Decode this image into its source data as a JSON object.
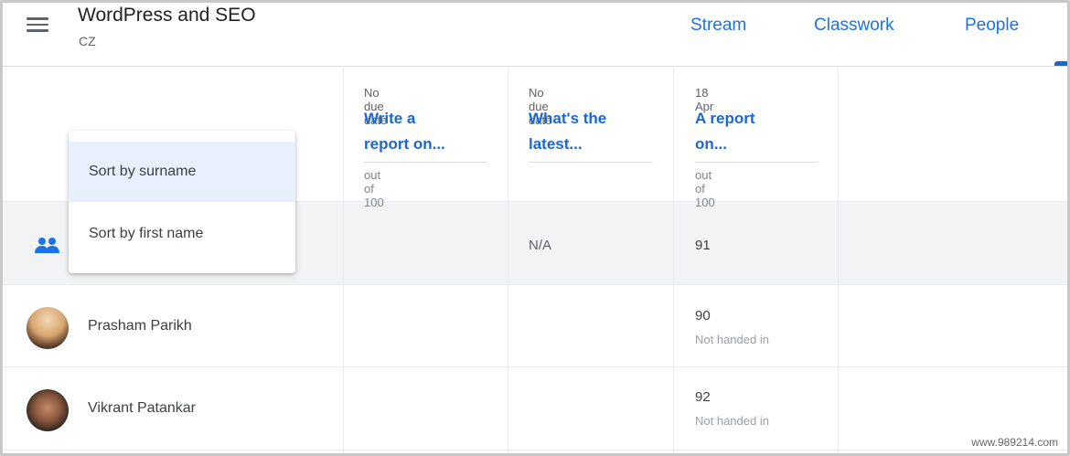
{
  "header": {
    "class_title": "WordPress and SEO",
    "class_section": "CZ",
    "tabs": [
      {
        "label": "Stream"
      },
      {
        "label": "Classwork"
      },
      {
        "label": "People"
      }
    ],
    "active_tab": "People"
  },
  "assignments": [
    {
      "due": "No due date",
      "title_line1": "Write a",
      "title_line2": "report on...",
      "points": "out of 100"
    },
    {
      "due": "No due date",
      "title_line1": "What's the",
      "title_line2": "latest...",
      "points": ""
    },
    {
      "due": "18 Apr",
      "title_line1": "A report",
      "title_line2": "on...",
      "points": "out of 100"
    }
  ],
  "class_average": {
    "values": [
      "",
      "N/A",
      "91"
    ]
  },
  "sort_menu": {
    "items": [
      "Sort by surname",
      "Sort by first name"
    ],
    "highlighted": "Sort by surname"
  },
  "students": [
    {
      "name": "Prasham Parikh",
      "grades": [
        {
          "value": "90",
          "status": "Not handed in"
        }
      ]
    },
    {
      "name": "Vikrant Patankar",
      "grades": [
        {
          "value": "92",
          "status": "Not handed in"
        }
      ]
    }
  ],
  "watermark": "www.989214.com",
  "colors": {
    "accent": "#1a73e8",
    "assignment_title": "#1967d2",
    "menu_highlight": "#e8f0fe",
    "class_avg_bg": "#f1f3f4"
  },
  "icons": [
    "menu-icon",
    "people-group-icon"
  ]
}
